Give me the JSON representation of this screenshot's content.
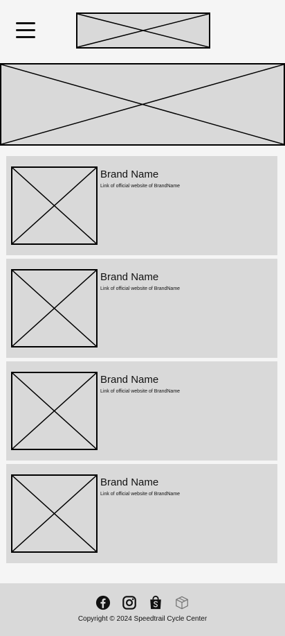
{
  "header": {
    "menu_icon": "hamburger-menu-icon",
    "logo_placeholder": "image-placeholder"
  },
  "banner": {
    "placeholder": "image-placeholder"
  },
  "brands": [
    {
      "name": "Brand Name",
      "link_text": "Link of official website of BrandName"
    },
    {
      "name": "Brand Name",
      "link_text": "Link of official website of BrandName"
    },
    {
      "name": "Brand Name",
      "link_text": "Link of official website of BrandName"
    },
    {
      "name": "Brand Name",
      "link_text": "Link of official website of BrandName"
    }
  ],
  "footer": {
    "social_icons": [
      "facebook-icon",
      "instagram-icon",
      "shopee-icon",
      "package-icon"
    ],
    "copyright": "Copyright © 2024 Speedtrail Cycle Center"
  },
  "colors": {
    "page_background": "#f5f5f5",
    "placeholder_fill": "#d9d9d9",
    "outline": "#000000"
  }
}
